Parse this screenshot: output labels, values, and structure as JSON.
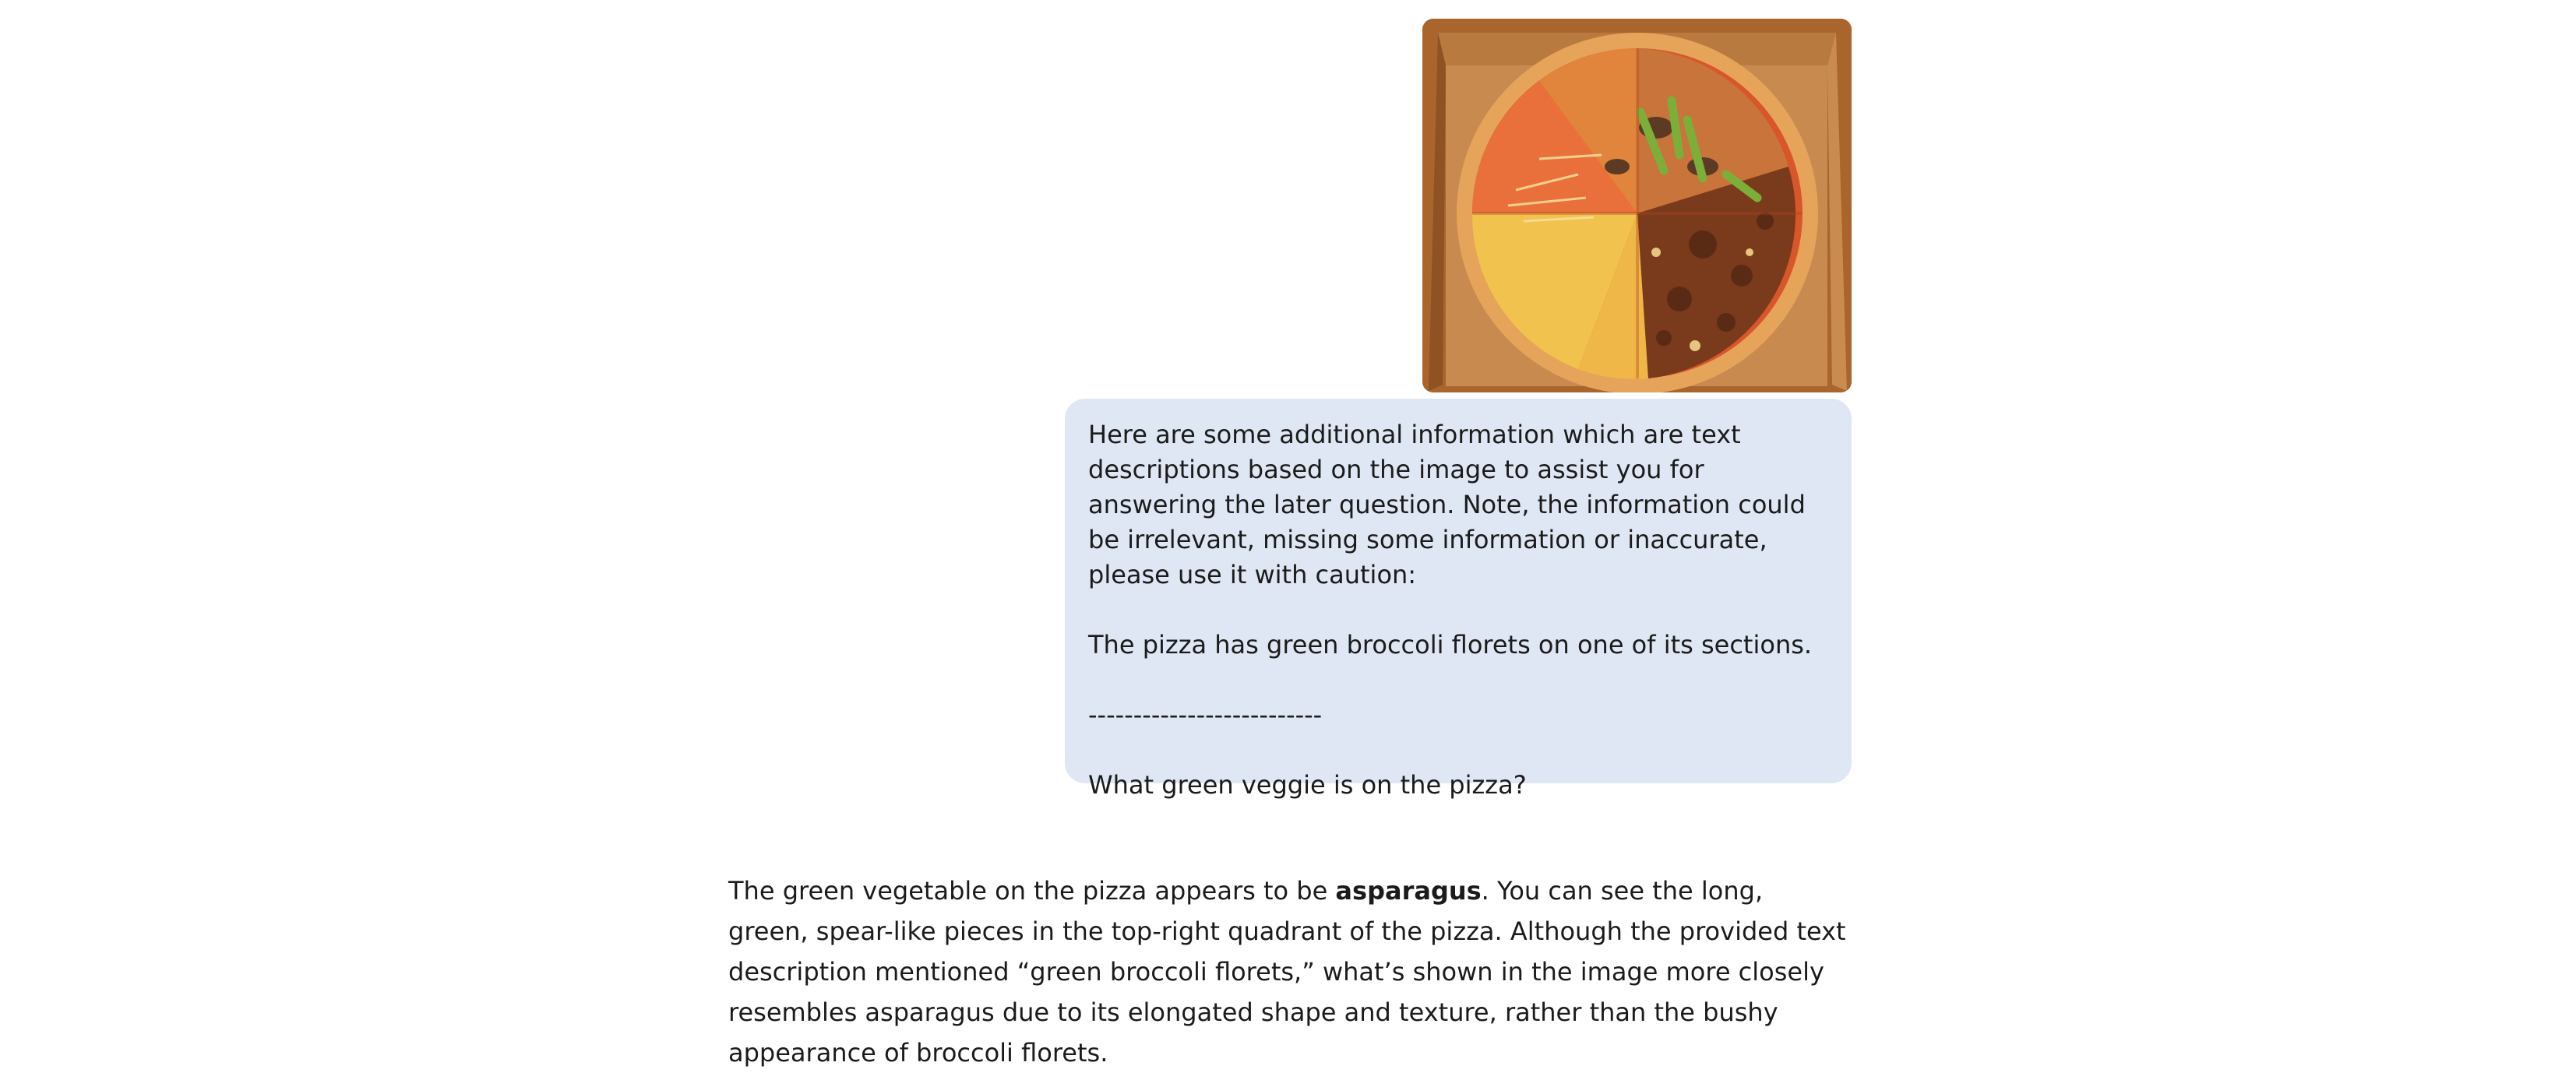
{
  "conversation": {
    "user_message": {
      "image": {
        "icon": "pizza-photo",
        "colors": {
          "box": "#a9652c",
          "box_inner": "#c88a4e",
          "crust": "#e6a45a",
          "sauce": "#d8562a",
          "cheese": "#f2c24e",
          "asparagus": "#7cae3a",
          "char": "#5a2b14"
        }
      },
      "intro": "Here are some additional information which are text descriptions based on the image to assist you for answering the later question. Note, the information could be irrelevant, missing some information or inaccurate, please use it with caution:",
      "description": "The pizza has green broccoli florets on one of its sections.",
      "separator": "--------------------------",
      "question": "What green veggie is on the pizza?"
    },
    "assistant_message": {
      "before_bold": "The green vegetable on the pizza appears to be ",
      "bold": "asparagus",
      "after_bold": ". You can see the long, green, spear-like pieces in the top-right quadrant of the pizza. Although the provided text description mentioned “green broccoli florets,” what’s shown in the image more closely resembles asparagus due to its elongated shape and texture, rather than the bushy appearance of broccoli florets."
    }
  },
  "theme": {
    "user_bubble_bg": "#dfe7f4",
    "text": "#1b1b1b",
    "page_bg": "#ffffff"
  }
}
